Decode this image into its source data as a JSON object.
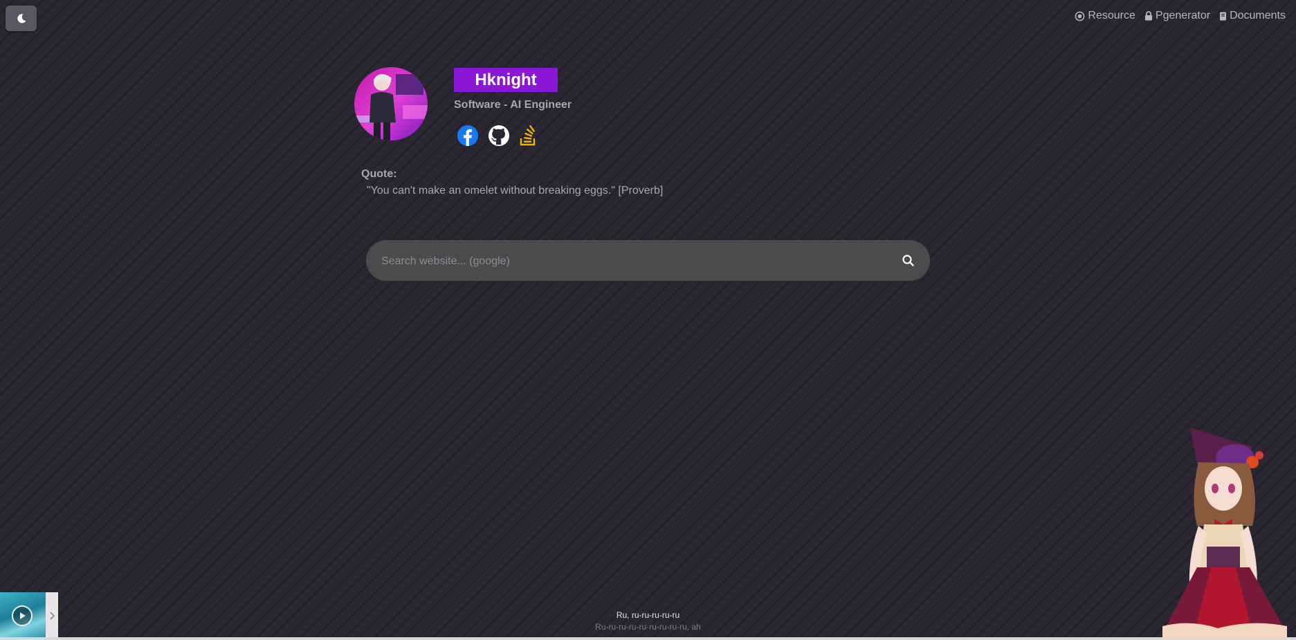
{
  "theme_toggle": {
    "icon": "moon-icon"
  },
  "nav": {
    "items": [
      {
        "label": "Resource",
        "icon": "target-icon"
      },
      {
        "label": "Pgenerator",
        "icon": "lock-icon"
      },
      {
        "label": "Documents",
        "icon": "document-icon"
      }
    ]
  },
  "profile": {
    "name": "Hknight",
    "subtitle": "Software - AI Engineer",
    "socials": [
      {
        "icon": "facebook-icon",
        "color": "#1877f2"
      },
      {
        "icon": "github-icon",
        "color": "#ffffff"
      },
      {
        "icon": "stackoverflow-icon",
        "color": "#f2b400"
      }
    ]
  },
  "quote": {
    "label": "Quote:",
    "text": "\"You can't make an omelet without breaking eggs.\" [Proverb]"
  },
  "search": {
    "placeholder": "Search website... (google)",
    "icon": "search-icon"
  },
  "player": {
    "lyric_current": "Ru, ru-ru-ru-ru-ru",
    "lyric_next": "Ru-ru-ru-ru-ru-ru-ru-ru-ru, ah"
  },
  "colors": {
    "accent": "#8a17d6",
    "background": "#2a2732",
    "search_bg": "#4c4a4d"
  }
}
